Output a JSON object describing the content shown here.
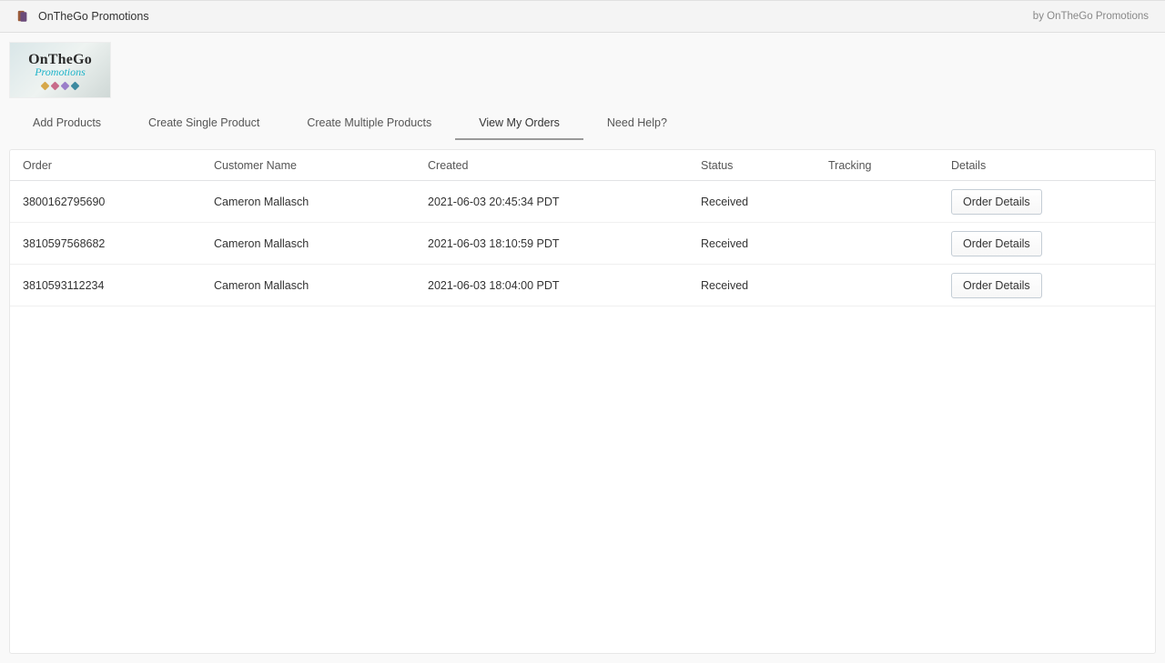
{
  "topbar": {
    "title": "OnTheGo Promotions",
    "byline": "by OnTheGo Promotions"
  },
  "logo": {
    "line1": "OnTheGo",
    "line2": "Promotions"
  },
  "tabs": [
    {
      "label": "Add Products",
      "active": false
    },
    {
      "label": "Create Single Product",
      "active": false
    },
    {
      "label": "Create Multiple Products",
      "active": false
    },
    {
      "label": "View My Orders",
      "active": true
    },
    {
      "label": "Need Help?",
      "active": false
    }
  ],
  "table": {
    "headers": {
      "order": "Order",
      "customer": "Customer Name",
      "created": "Created",
      "status": "Status",
      "tracking": "Tracking",
      "details": "Details"
    },
    "button_label": "Order Details",
    "rows": [
      {
        "order": "3800162795690",
        "customer": "Cameron Mallasch",
        "created": "2021-06-03 20:45:34 PDT",
        "status": "Received",
        "tracking": ""
      },
      {
        "order": "3810597568682",
        "customer": "Cameron Mallasch",
        "created": "2021-06-03 18:10:59 PDT",
        "status": "Received",
        "tracking": ""
      },
      {
        "order": "3810593112234",
        "customer": "Cameron Mallasch",
        "created": "2021-06-03 18:04:00 PDT",
        "status": "Received",
        "tracking": ""
      }
    ]
  }
}
